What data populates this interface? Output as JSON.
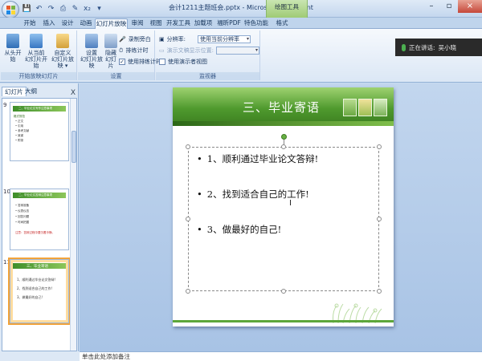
{
  "window": {
    "title": "会计1211主题班会.pptx - Microsoft PowerPoint",
    "context_tool": "绘图工具"
  },
  "qat": [
    "💾",
    "↶",
    "↷",
    "⎙",
    "✎",
    "x₂",
    "▾"
  ],
  "tabs": [
    "开始",
    "插入",
    "设计",
    "动画",
    "幻灯片放映",
    "审阅",
    "视图",
    "开发工具",
    "加载项",
    "福昕PDF",
    "特色功能",
    "格式"
  ],
  "active_tab": "幻灯片放映",
  "ribbon": {
    "start_group": {
      "label": "开始放映幻灯片",
      "from_beginning": "从头开始",
      "from_current_l1": "从当前",
      "from_current_l2": "幻灯片开始",
      "custom_l1": "自定义",
      "custom_l2": "幻灯片放映 ▾"
    },
    "setup_group": {
      "label": "设置",
      "setup_show_l1": "设置",
      "setup_show_l2": "幻灯片放映",
      "hide_l1": "隐藏",
      "hide_l2": "幻灯片",
      "record_narration": "录制旁白",
      "rehearse": "排练计时",
      "use_timings": "使用排练计时"
    },
    "monitor_group": {
      "label": "监视器",
      "resolution_label": "分辨率:",
      "resolution_value": "使用当前分辨率",
      "show_on_label": "演示文稿显示位置:",
      "presenter_view": "使用演示者视图"
    }
  },
  "presenter": {
    "speaking_label": "正在讲话:",
    "speaker": "吴小晓"
  },
  "left_pane": {
    "tab_slides": "幻灯片",
    "tab_outline": "大纲",
    "close": "X",
    "thumbs": [
      {
        "num": "9",
        "title": "二、毕业论文写作注意事项",
        "lines": [
          "格式规范",
          "• 正文",
          "• 引用",
          "• 参考文献",
          "• 致谢",
          "• 附录"
        ]
      },
      {
        "num": "10",
        "title": "二、毕业论文答辩注意事项",
        "lines": [
          "• 答辩准备",
          "• 仪表仪态",
          "• 回答问题",
          "• 时间把握"
        ],
        "note": "注意：答辩过程中要沉着冷静。"
      },
      {
        "num": "11",
        "title": "三、毕业寄语",
        "lines": [
          "1、顺利通过毕业论文答辩!",
          "2、找到适合自己的工作!",
          "3、做最好的自己!"
        ]
      }
    ]
  },
  "slide": {
    "title": "三、毕业寄语",
    "bullets": [
      "1、顺利通过毕业论文答辩!",
      "2、找到适合自己的工作!",
      "3、做最好的自己!"
    ]
  },
  "notes_placeholder": "单击此处添加备注",
  "colors": {
    "accent_green": "#4f9a2e",
    "ribbon_blue": "#c6d9ef",
    "selection_orange": "#f2a33a"
  }
}
